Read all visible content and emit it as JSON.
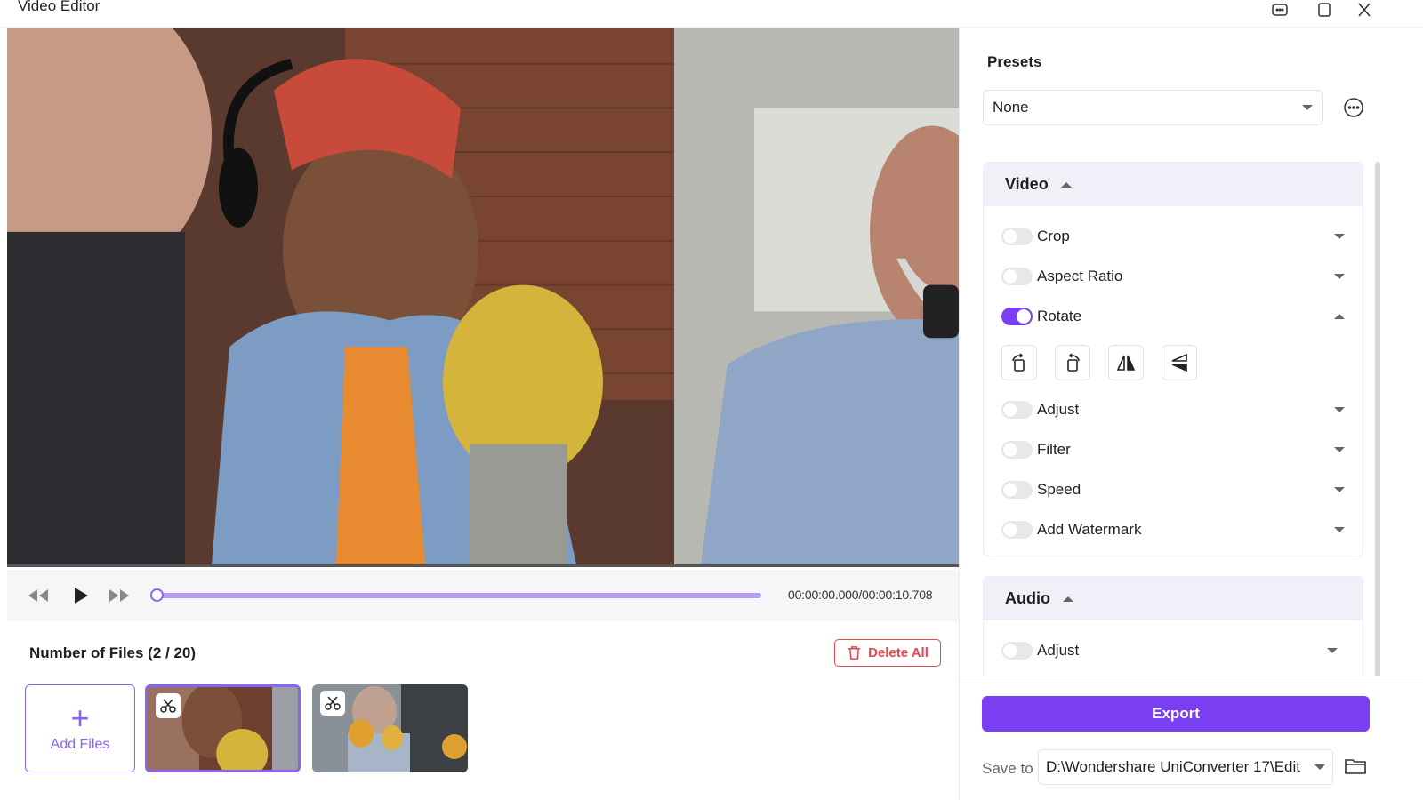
{
  "window": {
    "title": "Video Editor"
  },
  "player": {
    "time": "00:00:00.000/00:00:10.708",
    "progress_percent": 0
  },
  "files": {
    "header": "Number of Files (2 / 20)",
    "delete_all_label": "Delete All",
    "add_files_label": "Add Files"
  },
  "presets": {
    "label": "Presets",
    "selected": "None"
  },
  "video_section": {
    "title": "Video",
    "items": [
      {
        "label": "Crop",
        "enabled": false
      },
      {
        "label": "Aspect Ratio",
        "enabled": false
      },
      {
        "label": "Rotate",
        "enabled": true
      },
      {
        "label": "Adjust",
        "enabled": false
      },
      {
        "label": "Filter",
        "enabled": false
      },
      {
        "label": "Speed",
        "enabled": false
      },
      {
        "label": "Add Watermark",
        "enabled": false
      }
    ]
  },
  "audio_section": {
    "title": "Audio",
    "items": [
      {
        "label": "Adjust",
        "enabled": false
      }
    ]
  },
  "export": {
    "label": "Export"
  },
  "save_to": {
    "label": "Save to",
    "path": "D:\\Wondershare UniConverter 17\\Edit"
  },
  "colors": {
    "accent": "#7a3ff2",
    "danger": "#e5484d",
    "section_bg": "#f1f0f9"
  }
}
